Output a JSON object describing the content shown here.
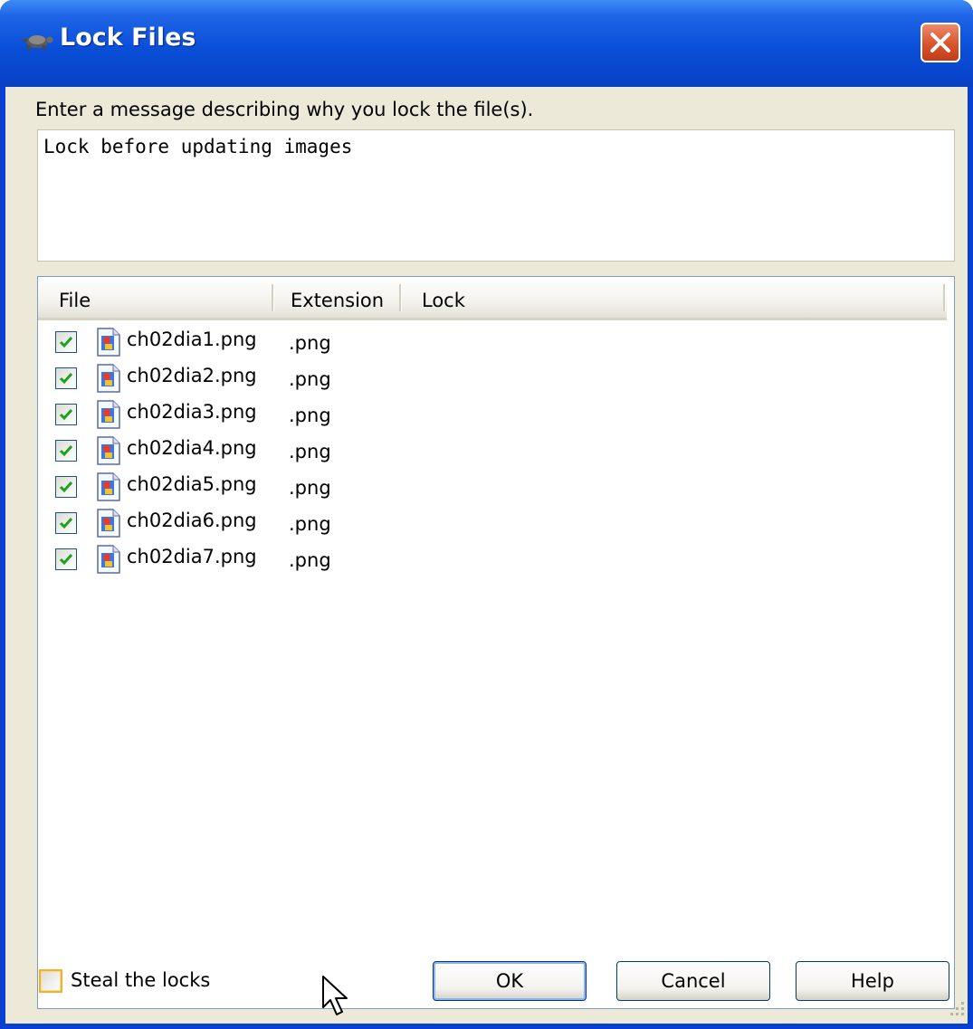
{
  "window": {
    "title": "Lock Files",
    "title_icon": "tortoise-icon",
    "close_icon": "close-icon"
  },
  "message": {
    "prompt": "Enter a message describing why you lock the file(s).",
    "value": "Lock before updating images"
  },
  "file_list": {
    "columns": [
      "File",
      "Extension",
      "Lock"
    ],
    "rows": [
      {
        "checked": true,
        "file": "ch02dia1.png",
        "extension": ".png",
        "lock": ""
      },
      {
        "checked": true,
        "file": "ch02dia2.png",
        "extension": ".png",
        "lock": ""
      },
      {
        "checked": true,
        "file": "ch02dia3.png",
        "extension": ".png",
        "lock": ""
      },
      {
        "checked": true,
        "file": "ch02dia4.png",
        "extension": ".png",
        "lock": ""
      },
      {
        "checked": true,
        "file": "ch02dia5.png",
        "extension": ".png",
        "lock": ""
      },
      {
        "checked": true,
        "file": "ch02dia6.png",
        "extension": ".png",
        "lock": ""
      },
      {
        "checked": true,
        "file": "ch02dia7.png",
        "extension": ".png",
        "lock": ""
      }
    ]
  },
  "steal_locks": {
    "label": "Steal the locks",
    "checked": false
  },
  "buttons": {
    "ok": "OK",
    "cancel": "Cancel",
    "help": "Help"
  },
  "colors": {
    "titlebar": "#0a4fd8",
    "dialog_bg": "#ece9d8",
    "close_button": "#d9542b",
    "checkbox_mark": "#21a121"
  }
}
